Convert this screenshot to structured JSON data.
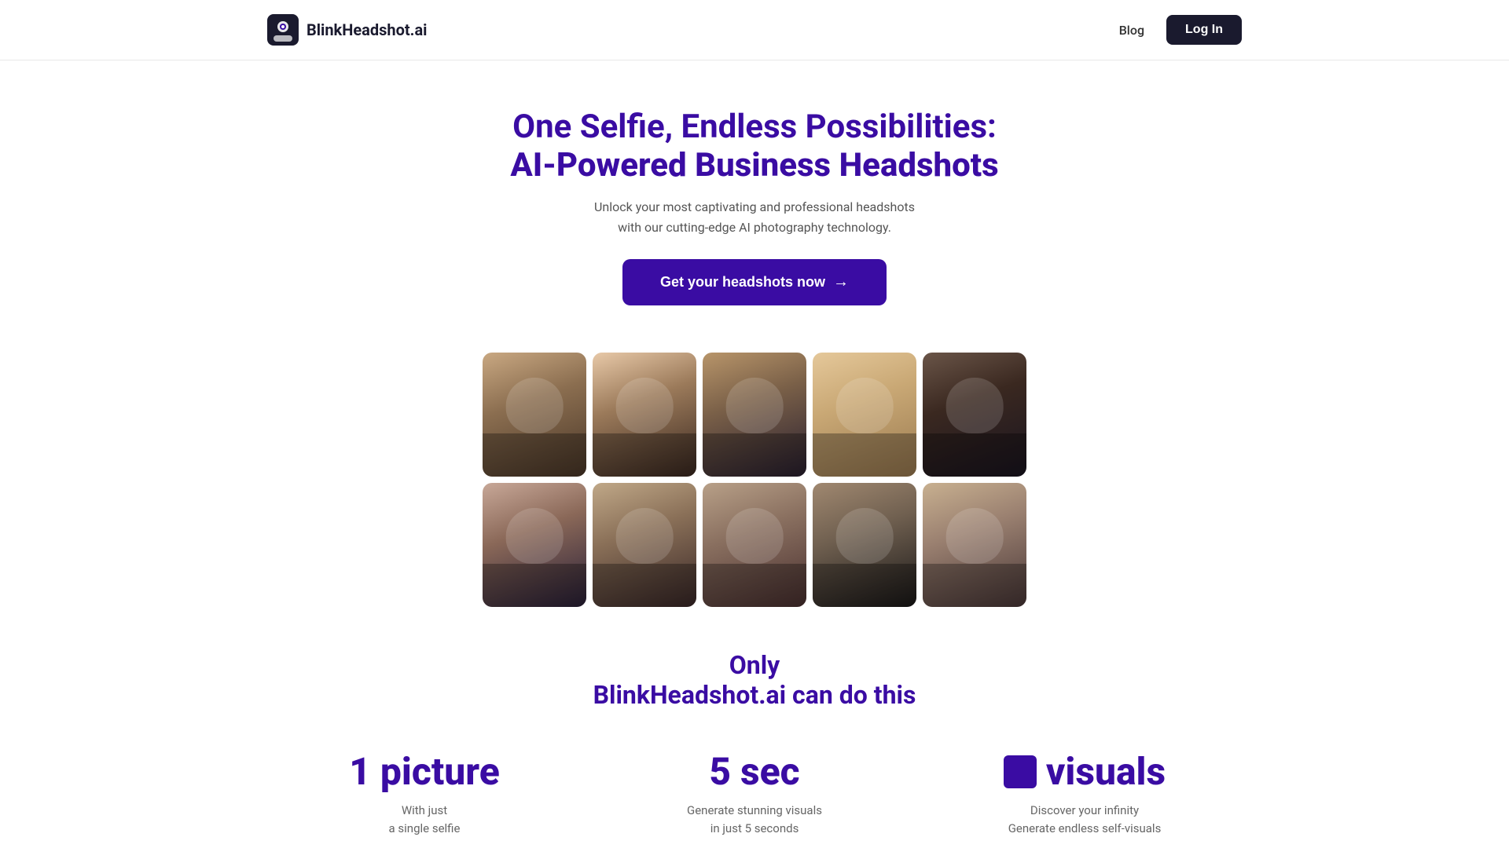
{
  "brand": {
    "name": "BlinkHeadshot.ai",
    "logo_alt": "BlinkHeadshot logo"
  },
  "navbar": {
    "blog_label": "Blog",
    "login_label": "Log In"
  },
  "hero": {
    "title_line1": "One Selfie, Endless Possibilities:",
    "title_line2": "AI-Powered Business Headshots",
    "subtitle_line1": "Unlock your most captivating and professional headshots",
    "subtitle_line2": "with our cutting-edge AI photography technology.",
    "cta_label": "Get your headshots now",
    "cta_arrow": "→"
  },
  "photos": {
    "row1": [
      {
        "id": 1,
        "alt": "Woman in grey blazer"
      },
      {
        "id": 2,
        "alt": "Asian woman professional"
      },
      {
        "id": 3,
        "alt": "Young man in suit with tie"
      },
      {
        "id": 4,
        "alt": "Blonde woman smiling"
      },
      {
        "id": 5,
        "alt": "Black man in suit"
      }
    ],
    "row2": [
      {
        "id": 6,
        "alt": "Young woman in black blazer"
      },
      {
        "id": 7,
        "alt": "Young man in grey suit"
      },
      {
        "id": 8,
        "alt": "Man in brown suit"
      },
      {
        "id": 9,
        "alt": "Man in dark suit with tie"
      },
      {
        "id": 10,
        "alt": "Man with city background"
      }
    ]
  },
  "only_section": {
    "line1": "Only",
    "line2": "BlinkHeadshot.ai can do this"
  },
  "stats": [
    {
      "value": "1 picture",
      "desc_line1": "With just",
      "desc_line2": "a single selfie",
      "type": "text"
    },
    {
      "value": "5 sec",
      "desc_line1": "Generate stunning visuals",
      "desc_line2": "in just 5 seconds",
      "type": "text"
    },
    {
      "value": "visuals",
      "desc_line1": "Discover your infinity",
      "desc_line2": "Generate endless self-visuals",
      "type": "icon-text",
      "icon": "square"
    }
  ]
}
